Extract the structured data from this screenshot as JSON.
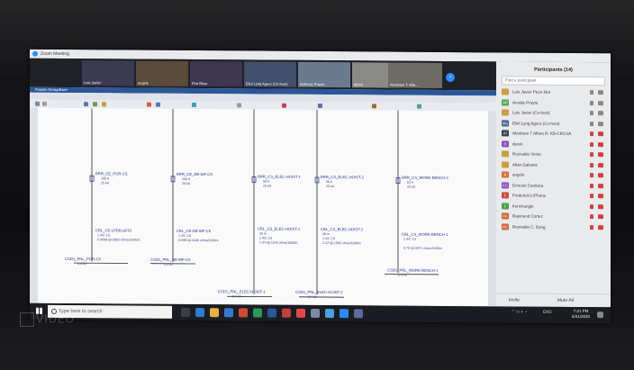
{
  "window": {
    "title": "Zoom Meeting"
  },
  "gallery": {
    "tiles": [
      {
        "name": "Luis Javier",
        "bg": "#3b3a52"
      },
      {
        "name": "angels",
        "bg": "#5a4a3a"
      },
      {
        "name": "Eha Bhaz",
        "bg": "#3e3550"
      },
      {
        "name": "Eliel Lyng Agero (Co-host)",
        "bg": "#43506b"
      },
      {
        "name": "Anthony Prayto",
        "bg": "#6b7a8f"
      },
      {
        "name": "derek",
        "bg": "#8a8a86"
      },
      {
        "name": "Abraham T. Alfa...",
        "bg": "#6e6a64"
      }
    ]
  },
  "participants": {
    "title": "Participants (14)",
    "search_placeholder": "Find a participant",
    "rows": [
      {
        "initials": "",
        "name": "Luis Javier Peon Mar",
        "color": "#c8a040",
        "muted": false
      },
      {
        "initials": "AP",
        "name": "Anoide Prayto",
        "color": "#5aa45a",
        "muted": false
      },
      {
        "initials": "",
        "name": "Luis Javier (Co-host)",
        "color": "#c8a040",
        "muted": false
      },
      {
        "initials": "MG",
        "name": "Eliel Lyng Agero (Co-host)",
        "color": "#4a5f8a",
        "muted": false
      },
      {
        "initials": "AT",
        "name": "Abraham T Alfaro R. KB-CRCSA",
        "color": "#3a3a4a",
        "muted": true
      },
      {
        "initials": "D",
        "name": "derek",
        "color": "#8a4fbf",
        "muted": true
      },
      {
        "initials": "",
        "name": "Reynaldo Veras",
        "color": "#c8a040",
        "muted": true
      },
      {
        "initials": "",
        "name": "Allan Galvane",
        "color": "#c8a040",
        "muted": true
      },
      {
        "initials": "A",
        "name": "angels",
        "color": "#e0703a",
        "muted": true
      },
      {
        "initials": "EC",
        "name": "Ernesto Cardona",
        "color": "#8a4fbf",
        "muted": true
      },
      {
        "initials": "F",
        "name": "Frederick's iPhone",
        "color": "#d04a3a",
        "muted": true
      },
      {
        "initials": "F",
        "name": "frenchangie",
        "color": "#4aa04a",
        "muted": true
      },
      {
        "initials": "RC",
        "name": "Raymond Cortez",
        "color": "#d0603a",
        "muted": true
      },
      {
        "initials": "RC",
        "name": "Reynaldo C. Bong",
        "color": "#d0603a",
        "muted": true
      }
    ],
    "invite_label": "Invite",
    "mute_all_label": "Mute All"
  },
  "cad": {
    "title": "Paladin DesignBase",
    "buses": [
      {
        "name": "BRR_CE_POR-CS",
        "line1": "100 A",
        "line2": "25 kA"
      },
      {
        "name": "BRR_CE_DB-WF-C5",
        "line1": "100 A",
        "line2": "25 kA"
      },
      {
        "name": "BRR_CS_ELEC-HOIST-1",
        "line1": "50 A",
        "line2": "25 kA"
      },
      {
        "name": "BRR_CS_ELEC-HOIST-2",
        "line1": "50 A",
        "line2": "25 kA"
      },
      {
        "name": "BRR_CS_WORK-BENCH-1",
        "line1": "63 A",
        "line2": "25 kA"
      }
    ],
    "cables": [
      {
        "name": "CBL_CE-LPDB-GF01",
        "line1": "1.4/C 1S",
        "line2": "0.0099+j0.0062 Ohms/1000m"
      },
      {
        "name": "CBL_CE-DB-WF-C5",
        "line1": "1.4/C 1S",
        "line2": "0.099+j0.1045 ohms/1000m"
      },
      {
        "name": "CBL_CS_ELEC-HOIST-1",
        "line1": "25 m",
        "line2": "1.4/C 1S"
      },
      {
        "name": "CBL_CS_ELEC-HOIST-2",
        "line1": "40 m",
        "line2": "1.4/C 1S"
      },
      {
        "name": "CBL_CS_WORK-BENCH-1",
        "line1": "1.4/C 1S",
        "line2": "0.70+j0.0972 ohms/1000m"
      }
    ],
    "cable_extra": [
      "1.47+j0.1106 ohms/1000m",
      "1.47+j0.1066 ohms/1000m"
    ],
    "loads": [
      {
        "name": "CSD1_PNL_POR-C5",
        "v": "0.4 kV"
      },
      {
        "name": "CSD1_PNL_DB-WF-C5",
        "v": "0.4 kV"
      },
      {
        "name": "CSD1_PNL_ELEC-HOIST-1",
        "v": "0.4 kV"
      },
      {
        "name": "CSD1_PNL_ELEC-HOIST-2",
        "v": "0.4 kV"
      },
      {
        "name": "CSD1_PNL_WORK-BENCH-1",
        "v": "0.4 kV"
      }
    ]
  },
  "taskbar": {
    "search_placeholder": "Type here to search",
    "tray_lang": "ENG",
    "time": "7:21 PM",
    "date": "5/31/2020"
  },
  "watermark": "VIDEO"
}
